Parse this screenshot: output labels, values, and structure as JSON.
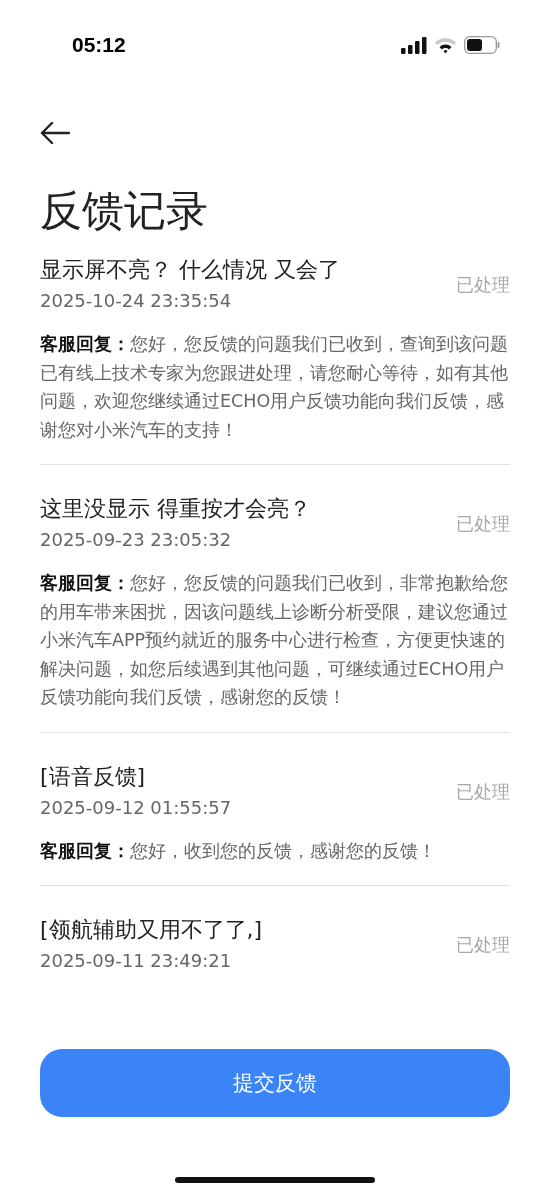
{
  "status_bar": {
    "time": "05:12"
  },
  "page_title": "反馈记录",
  "records": [
    {
      "title": "显示屏不亮？ 什么情况 又会了",
      "time": "2025-10-24 23:35:54",
      "status": "已处理",
      "reply": "**客服回复：**您好，您反馈的问题我们已收到，查询到该问题已有线上技术专家为您跟进处理，请您耐心等待，如有其他问题，欢迎您继续通过ECHO用户反馈功能向我们反馈，感谢您对小米汽车的支持！"
    },
    {
      "title": "这里没显示  得重按才会亮？",
      "time": "2025-09-23 23:05:32",
      "status": "已处理",
      "reply": "**客服回复：**您好，您反馈的问题我们已收到，非常抱歉给您的用车带来困扰，因该问题线上诊断分析受限，建议您通过小米汽车APP预约就近的服务中心进行检查，方便更快速的解决问题，如您后续遇到其他问题，可继续通过ECHO用户反馈功能向我们反馈，感谢您的反馈！"
    },
    {
      "title": "[语音反馈]",
      "time": "2025-09-12 01:55:57",
      "status": "已处理",
      "reply": "**客服回复：**您好，收到您的反馈，感谢您的反馈！"
    },
    {
      "title": "[领航辅助又用不了了,]",
      "time": "2025-09-11 23:49:21",
      "status": "已处理"
    }
  ],
  "submit_button": "提交反馈"
}
